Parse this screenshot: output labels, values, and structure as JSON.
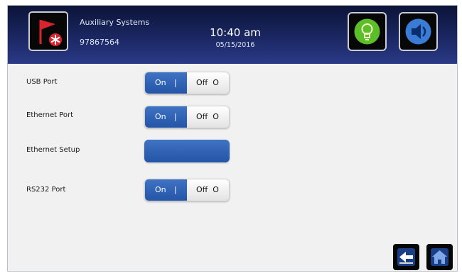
{
  "header": {
    "system_title": "Auxiliary Systems",
    "system_number": "97867564",
    "time": "10:40 am",
    "date": "05/15/2016",
    "icons": {
      "system": "red-flag-with-asterisk-icon",
      "light": "lightbulb-icon",
      "sound": "speaker-icon"
    }
  },
  "settings": {
    "usb": {
      "label": "USB Port",
      "on_label": "On",
      "off_label": "Off",
      "separator": "|",
      "off_mark": "O",
      "state": "on"
    },
    "ethernet": {
      "label": "Ethernet Port",
      "on_label": "On",
      "off_label": "Off",
      "separator": "|",
      "off_mark": "O",
      "state": "on"
    },
    "ethernet_setup": {
      "label": "Ethernet Setup",
      "button_label": ""
    },
    "rs232": {
      "label": "RS232 Port",
      "on_label": "On",
      "off_label": "Off",
      "separator": "|",
      "off_mark": "O",
      "state": "on"
    }
  },
  "nav": {
    "back_icon": "back-arrow-icon",
    "home_icon": "home-icon"
  },
  "colors": {
    "header_dark": "#0c1438",
    "header_light": "#2a3a86",
    "toggle_on": "#2455a6",
    "light_icon": "#5cbf2a",
    "sound_icon": "#3a7bd5",
    "flag": "#d9232e"
  }
}
